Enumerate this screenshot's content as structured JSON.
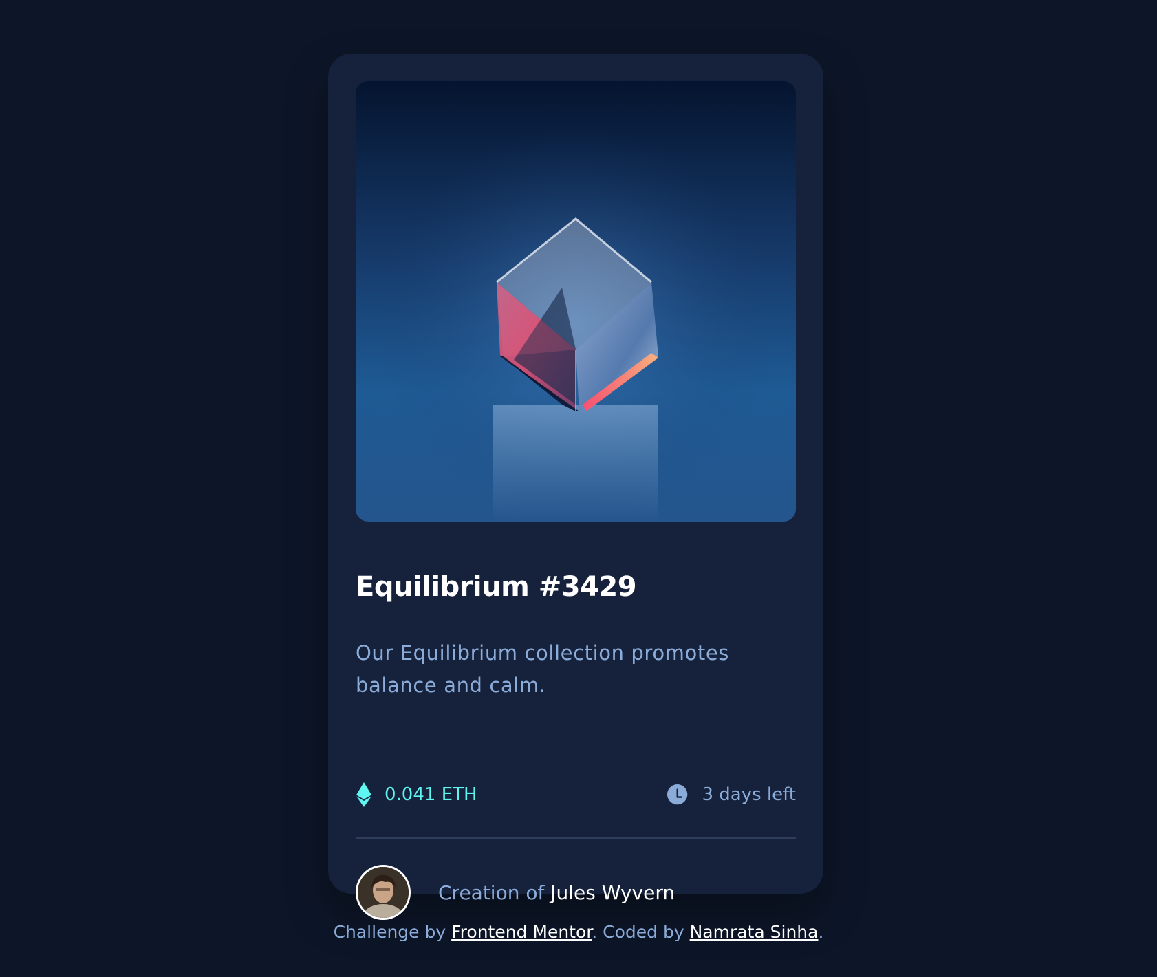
{
  "card": {
    "title": "Equilibrium #3429",
    "description": "Our Equilibrium collection promotes balance and calm.",
    "price": "0.041 ETH",
    "time_left": "3 days left",
    "creator_prefix": "Creation of",
    "creator_name": "Jules Wyvern"
  },
  "footer": {
    "challenge_prefix": "Challenge by",
    "challenge_link": "Frontend Mentor",
    "coded_prefix": ". Coded by",
    "coded_link": "Namrata Sinha",
    "suffix": "."
  },
  "colors": {
    "background": "#0d1628",
    "card": "#16223c",
    "accent_cyan": "#5ff5f0",
    "soft_blue": "#8bacd9",
    "white": "#ffffff"
  },
  "icons": {
    "price": "ethereum-icon",
    "time": "clock-icon",
    "hero": "equilibrium-cube-image",
    "avatar": "creator-avatar"
  }
}
